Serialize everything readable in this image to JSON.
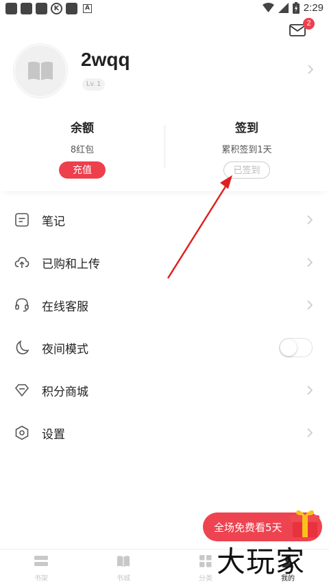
{
  "status_bar": {
    "time": "2:29",
    "k_glyph": "K",
    "a_glyph": "A"
  },
  "header": {
    "mail_badge": "2"
  },
  "profile": {
    "username": "2wqq",
    "level": "Lv. 1"
  },
  "stats": {
    "balance": {
      "title": "余额",
      "subtitle": "8红包",
      "button": "充值"
    },
    "checkin": {
      "title": "签到",
      "subtitle": "累积签到1天",
      "button": "已签到"
    }
  },
  "menu": [
    {
      "label": "笔记",
      "icon": "note-icon"
    },
    {
      "label": "已购和上传",
      "icon": "cloud-upload-icon"
    },
    {
      "label": "在线客服",
      "icon": "headset-icon"
    },
    {
      "label": "夜间模式",
      "icon": "moon-icon",
      "toggle": false
    },
    {
      "label": "积分商城",
      "icon": "diamond-icon"
    },
    {
      "label": "设置",
      "icon": "settings-icon"
    }
  ],
  "promo": {
    "text": "全场免费看5天"
  },
  "bottom_nav": [
    {
      "label": "书架",
      "icon": "bookshelf-icon"
    },
    {
      "label": "书城",
      "icon": "bookstore-icon"
    },
    {
      "label": "分类",
      "icon": "category-icon"
    },
    {
      "label": "我的",
      "icon": "profile-icon",
      "active": true
    }
  ],
  "watermark": "大玩家",
  "colors": {
    "accent": "#ee3f4d",
    "text": "#222222",
    "muted": "#c8c8c8"
  }
}
